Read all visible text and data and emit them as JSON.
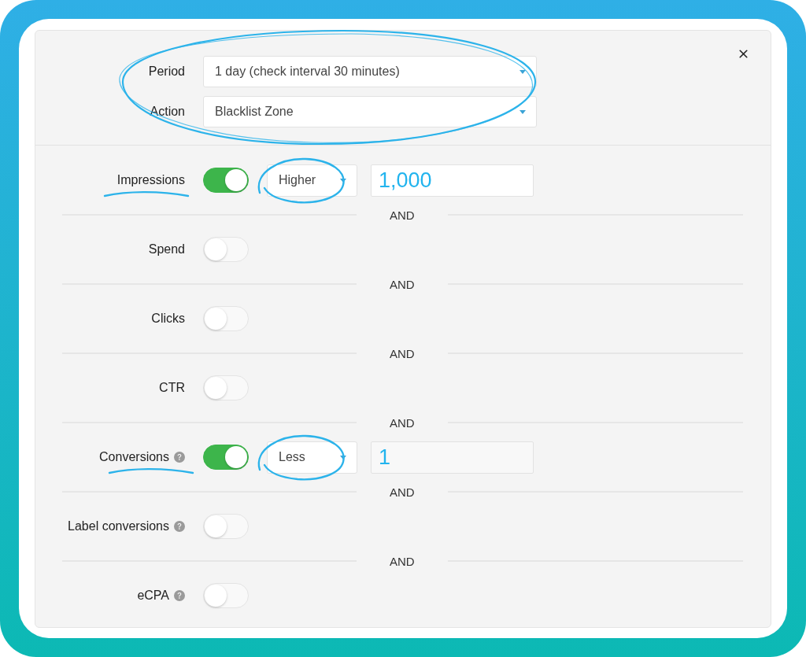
{
  "header": {
    "annotated": true,
    "fields": [
      {
        "label": "Period",
        "value": "1 day (check interval 30 minutes)"
      },
      {
        "label": "Action",
        "value": "Blacklist Zone"
      }
    ]
  },
  "conditions": [
    {
      "label": "Impressions",
      "help": false,
      "on": true,
      "annotated": true,
      "comparison": "Higher",
      "value": "1,000"
    },
    {
      "label": "Spend",
      "help": false,
      "on": false,
      "annotated": false
    },
    {
      "label": "Clicks",
      "help": false,
      "on": false,
      "annotated": false
    },
    {
      "label": "CTR",
      "help": false,
      "on": false,
      "annotated": false
    },
    {
      "label": "Conversions",
      "help": true,
      "on": true,
      "annotated": true,
      "comparison": "Less",
      "value": "1"
    },
    {
      "label": "Label conversions",
      "help": true,
      "on": false,
      "annotated": false
    },
    {
      "label": "eCPA",
      "help": true,
      "on": false,
      "annotated": false
    }
  ],
  "separators": [
    "AND",
    "AND",
    "AND",
    "AND",
    "AND",
    "AND"
  ]
}
